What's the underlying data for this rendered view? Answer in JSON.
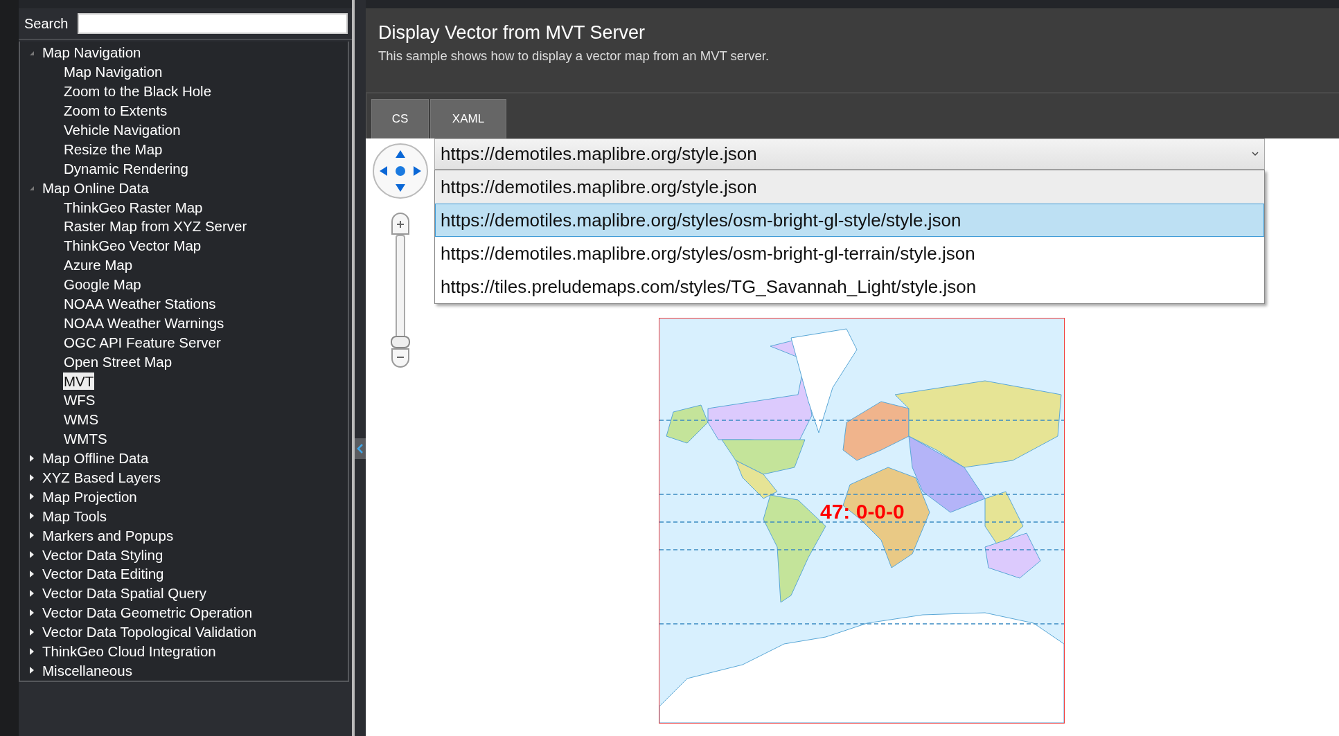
{
  "sidebar": {
    "search": {
      "label": "Search"
    },
    "tree": [
      {
        "label": "Map Navigation",
        "expanded": true,
        "children": [
          {
            "label": "Map Navigation",
            "selected": false
          },
          {
            "label": "Zoom to the Black Hole",
            "selected": false
          },
          {
            "label": "Zoom to Extents",
            "selected": false
          },
          {
            "label": "Vehicle Navigation",
            "selected": false
          },
          {
            "label": "Resize the Map",
            "selected": false
          },
          {
            "label": "Dynamic Rendering",
            "selected": false
          }
        ]
      },
      {
        "label": "Map Online Data",
        "expanded": true,
        "children": [
          {
            "label": "ThinkGeo Raster Map",
            "selected": false
          },
          {
            "label": "Raster Map from XYZ Server",
            "selected": false
          },
          {
            "label": "ThinkGeo Vector Map",
            "selected": false
          },
          {
            "label": "Azure Map",
            "selected": false
          },
          {
            "label": "Google Map",
            "selected": false
          },
          {
            "label": "NOAA Weather Stations",
            "selected": false
          },
          {
            "label": "NOAA Weather Warnings",
            "selected": false
          },
          {
            "label": "OGC API Feature Server",
            "selected": false
          },
          {
            "label": "Open Street Map",
            "selected": false
          },
          {
            "label": "MVT",
            "selected": true
          },
          {
            "label": "WFS",
            "selected": false
          },
          {
            "label": "WMS",
            "selected": false
          },
          {
            "label": "WMTS",
            "selected": false
          }
        ]
      },
      {
        "label": "Map Offline Data",
        "expanded": false
      },
      {
        "label": "XYZ Based Layers",
        "expanded": false
      },
      {
        "label": "Map Projection",
        "expanded": false
      },
      {
        "label": "Map Tools",
        "expanded": false
      },
      {
        "label": "Markers and Popups",
        "expanded": false
      },
      {
        "label": "Vector Data Styling",
        "expanded": false
      },
      {
        "label": "Vector Data Editing",
        "expanded": false
      },
      {
        "label": "Vector Data Spatial Query",
        "expanded": false
      },
      {
        "label": "Vector Data Geometric Operation",
        "expanded": false
      },
      {
        "label": "Vector Data Topological Validation",
        "expanded": false
      },
      {
        "label": "ThinkGeo Cloud Integration",
        "expanded": false
      },
      {
        "label": "Miscellaneous",
        "expanded": false
      }
    ]
  },
  "header": {
    "title": "Display Vector from MVT Server",
    "subtitle": "This sample shows how to display a vector map from an MVT server."
  },
  "tabs": [
    {
      "label": "CS",
      "selected": false
    },
    {
      "label": "XAML",
      "selected": false
    }
  ],
  "zoom_slider": {
    "level": 0
  },
  "style_select": {
    "value": "https://demotiles.maplibre.org/style.json",
    "expanded": true,
    "options": [
      {
        "label": "https://demotiles.maplibre.org/style.json",
        "selected": true,
        "highlighted": false
      },
      {
        "label": "https://demotiles.maplibre.org/styles/osm-bright-gl-style/style.json",
        "selected": false,
        "highlighted": true
      },
      {
        "label": "https://demotiles.maplibre.org/styles/osm-bright-gl-terrain/style.json",
        "selected": false,
        "highlighted": false
      },
      {
        "label": "https://tiles.preludemaps.com/styles/TG_Savannah_Light/style.json",
        "selected": false,
        "highlighted": false
      }
    ]
  },
  "map": {
    "tile_label": "47: 0-0-0"
  }
}
